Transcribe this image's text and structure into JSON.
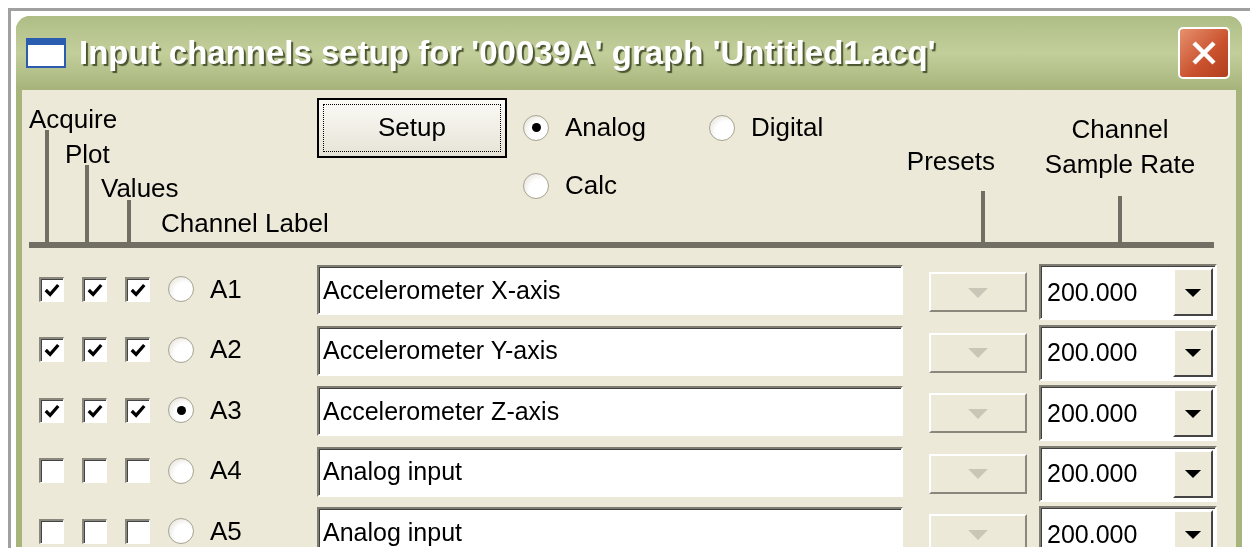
{
  "window": {
    "title": "Input channels setup for '00039A' graph 'Untitled1.acq'"
  },
  "column_headers": [
    "Acquire",
    "Plot",
    "Values",
    "Channel Label"
  ],
  "setup_button": "Setup",
  "channel_types": [
    {
      "label": "Analog",
      "selected": true
    },
    {
      "label": "Digital",
      "selected": false
    },
    {
      "label": "Calc",
      "selected": false
    }
  ],
  "presets_header": "Presets",
  "sample_rate_header": "Channel Sample Rate",
  "channels": [
    {
      "acquire": true,
      "plot": true,
      "values": true,
      "selected": false,
      "channel": "A1",
      "label": "Accelerometer X-axis",
      "presets_disabled": true,
      "sample_rate": "200.000"
    },
    {
      "acquire": true,
      "plot": true,
      "values": true,
      "selected": false,
      "channel": "A2",
      "label": "Accelerometer Y-axis",
      "presets_disabled": true,
      "sample_rate": "200.000"
    },
    {
      "acquire": true,
      "plot": true,
      "values": true,
      "selected": true,
      "channel": "A3",
      "label": "Accelerometer Z-axis",
      "presets_disabled": true,
      "sample_rate": "200.000"
    },
    {
      "acquire": false,
      "plot": false,
      "values": false,
      "selected": false,
      "channel": "A4",
      "label": "Analog input",
      "presets_disabled": true,
      "sample_rate": "200.000"
    },
    {
      "acquire": false,
      "plot": false,
      "values": false,
      "selected": false,
      "channel": "A5",
      "label": "Analog input",
      "presets_disabled": true,
      "sample_rate": "200.000"
    }
  ]
}
